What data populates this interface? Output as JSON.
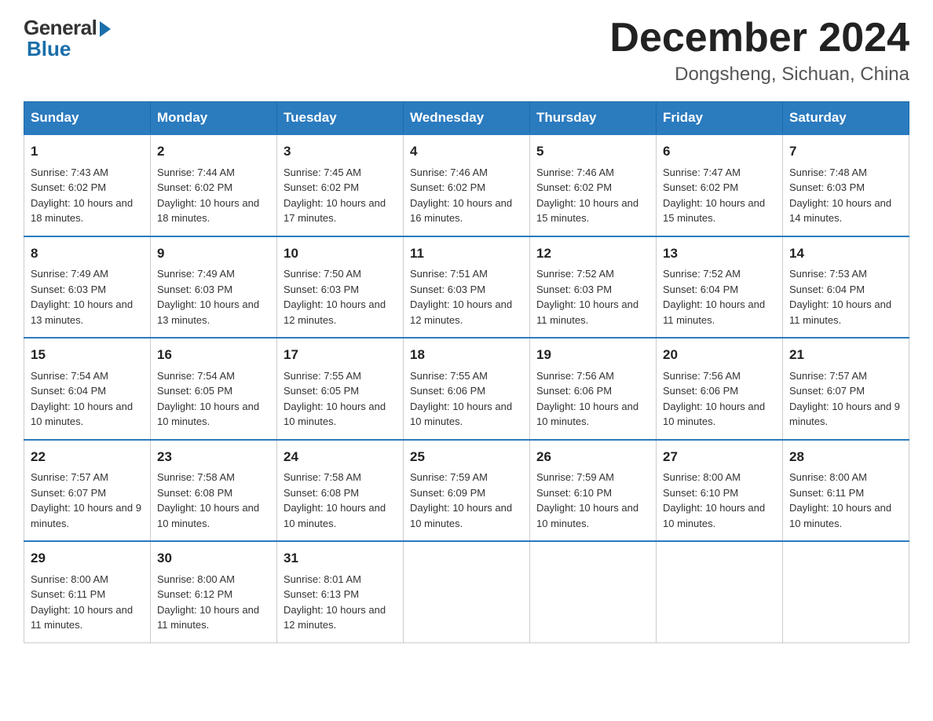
{
  "logo": {
    "general": "General",
    "blue": "Blue"
  },
  "header": {
    "month_year": "December 2024",
    "location": "Dongsheng, Sichuan, China"
  },
  "days_of_week": [
    "Sunday",
    "Monday",
    "Tuesday",
    "Wednesday",
    "Thursday",
    "Friday",
    "Saturday"
  ],
  "weeks": [
    [
      {
        "day": "1",
        "sunrise": "7:43 AM",
        "sunset": "6:02 PM",
        "daylight": "10 hours and 18 minutes."
      },
      {
        "day": "2",
        "sunrise": "7:44 AM",
        "sunset": "6:02 PM",
        "daylight": "10 hours and 18 minutes."
      },
      {
        "day": "3",
        "sunrise": "7:45 AM",
        "sunset": "6:02 PM",
        "daylight": "10 hours and 17 minutes."
      },
      {
        "day": "4",
        "sunrise": "7:46 AM",
        "sunset": "6:02 PM",
        "daylight": "10 hours and 16 minutes."
      },
      {
        "day": "5",
        "sunrise": "7:46 AM",
        "sunset": "6:02 PM",
        "daylight": "10 hours and 15 minutes."
      },
      {
        "day": "6",
        "sunrise": "7:47 AM",
        "sunset": "6:02 PM",
        "daylight": "10 hours and 15 minutes."
      },
      {
        "day": "7",
        "sunrise": "7:48 AM",
        "sunset": "6:03 PM",
        "daylight": "10 hours and 14 minutes."
      }
    ],
    [
      {
        "day": "8",
        "sunrise": "7:49 AM",
        "sunset": "6:03 PM",
        "daylight": "10 hours and 13 minutes."
      },
      {
        "day": "9",
        "sunrise": "7:49 AM",
        "sunset": "6:03 PM",
        "daylight": "10 hours and 13 minutes."
      },
      {
        "day": "10",
        "sunrise": "7:50 AM",
        "sunset": "6:03 PM",
        "daylight": "10 hours and 12 minutes."
      },
      {
        "day": "11",
        "sunrise": "7:51 AM",
        "sunset": "6:03 PM",
        "daylight": "10 hours and 12 minutes."
      },
      {
        "day": "12",
        "sunrise": "7:52 AM",
        "sunset": "6:03 PM",
        "daylight": "10 hours and 11 minutes."
      },
      {
        "day": "13",
        "sunrise": "7:52 AM",
        "sunset": "6:04 PM",
        "daylight": "10 hours and 11 minutes."
      },
      {
        "day": "14",
        "sunrise": "7:53 AM",
        "sunset": "6:04 PM",
        "daylight": "10 hours and 11 minutes."
      }
    ],
    [
      {
        "day": "15",
        "sunrise": "7:54 AM",
        "sunset": "6:04 PM",
        "daylight": "10 hours and 10 minutes."
      },
      {
        "day": "16",
        "sunrise": "7:54 AM",
        "sunset": "6:05 PM",
        "daylight": "10 hours and 10 minutes."
      },
      {
        "day": "17",
        "sunrise": "7:55 AM",
        "sunset": "6:05 PM",
        "daylight": "10 hours and 10 minutes."
      },
      {
        "day": "18",
        "sunrise": "7:55 AM",
        "sunset": "6:06 PM",
        "daylight": "10 hours and 10 minutes."
      },
      {
        "day": "19",
        "sunrise": "7:56 AM",
        "sunset": "6:06 PM",
        "daylight": "10 hours and 10 minutes."
      },
      {
        "day": "20",
        "sunrise": "7:56 AM",
        "sunset": "6:06 PM",
        "daylight": "10 hours and 10 minutes."
      },
      {
        "day": "21",
        "sunrise": "7:57 AM",
        "sunset": "6:07 PM",
        "daylight": "10 hours and 9 minutes."
      }
    ],
    [
      {
        "day": "22",
        "sunrise": "7:57 AM",
        "sunset": "6:07 PM",
        "daylight": "10 hours and 9 minutes."
      },
      {
        "day": "23",
        "sunrise": "7:58 AM",
        "sunset": "6:08 PM",
        "daylight": "10 hours and 10 minutes."
      },
      {
        "day": "24",
        "sunrise": "7:58 AM",
        "sunset": "6:08 PM",
        "daylight": "10 hours and 10 minutes."
      },
      {
        "day": "25",
        "sunrise": "7:59 AM",
        "sunset": "6:09 PM",
        "daylight": "10 hours and 10 minutes."
      },
      {
        "day": "26",
        "sunrise": "7:59 AM",
        "sunset": "6:10 PM",
        "daylight": "10 hours and 10 minutes."
      },
      {
        "day": "27",
        "sunrise": "8:00 AM",
        "sunset": "6:10 PM",
        "daylight": "10 hours and 10 minutes."
      },
      {
        "day": "28",
        "sunrise": "8:00 AM",
        "sunset": "6:11 PM",
        "daylight": "10 hours and 10 minutes."
      }
    ],
    [
      {
        "day": "29",
        "sunrise": "8:00 AM",
        "sunset": "6:11 PM",
        "daylight": "10 hours and 11 minutes."
      },
      {
        "day": "30",
        "sunrise": "8:00 AM",
        "sunset": "6:12 PM",
        "daylight": "10 hours and 11 minutes."
      },
      {
        "day": "31",
        "sunrise": "8:01 AM",
        "sunset": "6:13 PM",
        "daylight": "10 hours and 12 minutes."
      },
      null,
      null,
      null,
      null
    ]
  ]
}
